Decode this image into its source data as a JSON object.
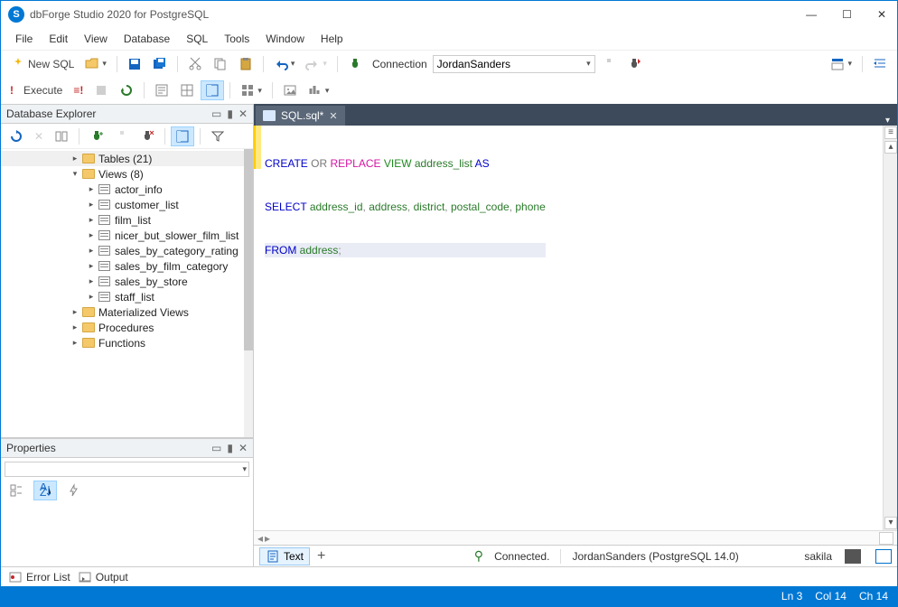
{
  "window": {
    "title": "dbForge Studio 2020 for PostgreSQL"
  },
  "menu": [
    "File",
    "Edit",
    "View",
    "Database",
    "SQL",
    "Tools",
    "Window",
    "Help"
  ],
  "toolbar": {
    "newSql": "New SQL",
    "connLabel": "Connection",
    "connValue": "JordanSanders"
  },
  "execToolbar": {
    "execute": "Execute"
  },
  "explorer": {
    "title": "Database Explorer",
    "tree": [
      {
        "level": 2,
        "exp": "▸",
        "type": "folder",
        "label": "Tables (21)"
      },
      {
        "level": 2,
        "exp": "▾",
        "type": "folder",
        "label": "Views (8)"
      },
      {
        "level": 3,
        "exp": "▸",
        "type": "view",
        "label": "actor_info"
      },
      {
        "level": 3,
        "exp": "▸",
        "type": "view",
        "label": "customer_list"
      },
      {
        "level": 3,
        "exp": "▸",
        "type": "view",
        "label": "film_list"
      },
      {
        "level": 3,
        "exp": "▸",
        "type": "view",
        "label": "nicer_but_slower_film_list"
      },
      {
        "level": 3,
        "exp": "▸",
        "type": "view",
        "label": "sales_by_category_rating"
      },
      {
        "level": 3,
        "exp": "▸",
        "type": "view",
        "label": "sales_by_film_category"
      },
      {
        "level": 3,
        "exp": "▸",
        "type": "view",
        "label": "sales_by_store"
      },
      {
        "level": 3,
        "exp": "▸",
        "type": "view",
        "label": "staff_list"
      },
      {
        "level": 2,
        "exp": "▸",
        "type": "folder",
        "label": "Materialized Views"
      },
      {
        "level": 2,
        "exp": "▸",
        "type": "folder",
        "label": "Procedures"
      },
      {
        "level": 2,
        "exp": "▸",
        "type": "folder",
        "label": "Functions"
      }
    ]
  },
  "properties": {
    "title": "Properties"
  },
  "tab": {
    "label": "SQL.sql*"
  },
  "code": {
    "line1": {
      "create": "CREATE",
      "or": "OR",
      "replace": "REPLACE",
      "view": "VIEW",
      "ident": "address_list",
      "as": "AS"
    },
    "line2": {
      "select": "SELECT",
      "c1": "address_id",
      "c2": "address",
      "c3": "district",
      "c4": "postal_code",
      "c5": "phone"
    },
    "line3": {
      "from": "FROM",
      "tbl": "address"
    }
  },
  "editorStatus": {
    "text": "Text",
    "connected": "Connected.",
    "conn": "JordanSanders (PostgreSQL 14.0)",
    "db": "sakila"
  },
  "bottomTabs": {
    "errorList": "Error List",
    "output": "Output"
  },
  "status": {
    "ln": "Ln 3",
    "col": "Col 14",
    "ch": "Ch 14"
  }
}
